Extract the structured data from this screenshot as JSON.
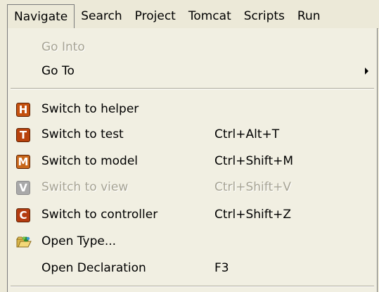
{
  "menubar": {
    "items": [
      "Navigate",
      "Search",
      "Project",
      "Tomcat",
      "Scripts",
      "Run"
    ],
    "active": "Navigate"
  },
  "menu": {
    "items": [
      {
        "label": "Go Into",
        "disabled": true
      },
      {
        "label": "Go To",
        "submenu": true
      },
      {
        "label": "Switch to helper",
        "icon": "helper-h-icon",
        "letter": "H",
        "color": "#c4500e"
      },
      {
        "label": "Switch to test",
        "shortcut": "Ctrl+Alt+T",
        "icon": "test-t-icon",
        "letter": "T",
        "color": "#b8420c"
      },
      {
        "label": "Switch to model",
        "shortcut": "Ctrl+Shift+M",
        "icon": "model-m-icon",
        "letter": "M",
        "color": "#c8671a"
      },
      {
        "label": "Switch to view",
        "shortcut": "Ctrl+Shift+V",
        "icon": "view-v-icon",
        "letter": "V",
        "color": "#a9a9a9",
        "disabled": true
      },
      {
        "label": "Switch to controller",
        "shortcut": "Ctrl+Shift+Z",
        "icon": "controller-c-icon",
        "letter": "C",
        "color": "#b43c10"
      },
      {
        "label": "Open Type...",
        "icon": "open-type-folder-icon"
      },
      {
        "label": "Open Declaration",
        "shortcut": "F3"
      }
    ]
  }
}
